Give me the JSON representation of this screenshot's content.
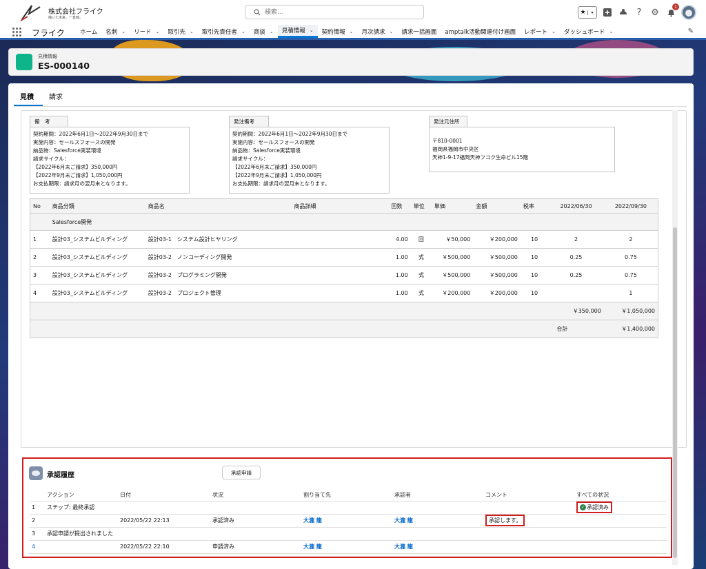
{
  "header": {
    "company": "株式会社フライク",
    "tagline": "描いた未来、一直線。",
    "search_placeholder": "検索...",
    "notification_count": "1"
  },
  "nav": {
    "app_name": "フライク",
    "items": [
      {
        "label": "ホーム",
        "chevron": false
      },
      {
        "label": "名刺",
        "chevron": true
      },
      {
        "label": "リード",
        "chevron": true
      },
      {
        "label": "取引先",
        "chevron": true
      },
      {
        "label": "取引先責任者",
        "chevron": true
      },
      {
        "label": "商談",
        "chevron": true
      },
      {
        "label": "見積情報",
        "chevron": true,
        "active": true
      },
      {
        "label": "契約情報",
        "chevron": true
      },
      {
        "label": "月次請求",
        "chevron": true
      },
      {
        "label": "請求一括画面",
        "chevron": false
      },
      {
        "label": "amptalk活動関連付け画面",
        "chevron": false
      },
      {
        "label": "レポート",
        "chevron": true
      },
      {
        "label": "ダッシュボード",
        "chevron": true
      }
    ]
  },
  "record": {
    "type": "見積情報",
    "name": "ES-000140"
  },
  "tabs": [
    "見積",
    "請求"
  ],
  "notes": {
    "remarks_label": "備　考",
    "remarks_lines": [
      "契約期間：2022年6月1日～2022年9月30日まで",
      "実施内容：セールスフォースの開発",
      "納品物：Salesforce実装環境",
      "請求サイクル：",
      "【2022年6月末ご請求】350,000円",
      "【2022年9月末ご請求】1,050,000円",
      "お支払期限：請求月の翌月末となります。"
    ],
    "order_remarks_label": "発注備考",
    "order_remarks_lines": [
      "契約期間：2022年6月1日～2022年9月30日まで",
      "実施内容：セールスフォースの開発",
      "納品物：Salesforce実装環境",
      "請求サイクル：",
      "【2022年6月末ご請求】350,000円",
      "【2022年9月末ご請求】1,050,000円",
      "お支払期限：請求月の翌月末となります。"
    ],
    "address_label": "発注元住所",
    "address_lines": [
      "〒810-0001",
      "福岡県福岡市中央区",
      "天神1-9-17福岡天神フコク生命ビル15階"
    ]
  },
  "items": {
    "headers": [
      "No",
      "商品分類",
      "商品名",
      "商品詳細",
      "回数",
      "単位",
      "単価",
      "金額",
      "税率",
      "2022/06/30",
      "2022/09/30"
    ],
    "group": "Salesforce開発",
    "rows": [
      {
        "no": "1",
        "category": "設計03_システムビルディング",
        "product": "設計03-1　システム設計ヒヤリング",
        "detail": "",
        "qty": "4.00",
        "unit": "回",
        "price": "￥50,000",
        "amount": "￥200,000",
        "tax": "10",
        "d1": "2",
        "d2": "2"
      },
      {
        "no": "2",
        "category": "設計03_システムビルディング",
        "product": "設計03-2　ノンコーディング開発",
        "detail": "",
        "qty": "1.00",
        "unit": "式",
        "price": "￥500,000",
        "amount": "￥500,000",
        "tax": "10",
        "d1": "0.25",
        "d2": "0.75"
      },
      {
        "no": "3",
        "category": "設計03_システムビルディング",
        "product": "設計03-2　プログラミング開発",
        "detail": "",
        "qty": "1.00",
        "unit": "式",
        "price": "￥500,000",
        "amount": "￥500,000",
        "tax": "10",
        "d1": "0.25",
        "d2": "0.75"
      },
      {
        "no": "4",
        "category": "設計03_システムビルディング",
        "product": "設計03-2　プロジェクト管理",
        "detail": "",
        "qty": "1.00",
        "unit": "式",
        "price": "￥200,000",
        "amount": "￥200,000",
        "tax": "10",
        "d1": "",
        "d2": "1"
      }
    ],
    "subtotal_d1": "￥350,000",
    "subtotal_d2": "￥1,050,000",
    "total_label": "合計",
    "total_value": "￥1,400,000"
  },
  "approval": {
    "title": "承認履歴",
    "button": "承認申請",
    "headers": [
      "アクション",
      "日付",
      "状況",
      "割り当て先",
      "承認者",
      "コメント",
      "すべての状況"
    ],
    "rows": [
      {
        "no": "1",
        "action": "ステップ: 最終承認",
        "date": "",
        "status": "",
        "assignee": "",
        "approver": "",
        "comment": "",
        "overall": "承認済み"
      },
      {
        "no": "2",
        "action": "",
        "date": "2022/05/22 22:13",
        "status": "承認済み",
        "assignee": "大瀧 龍",
        "approver": "大瀧 龍",
        "comment": "承認します。",
        "overall": ""
      },
      {
        "no": "3",
        "action": "承認申請が提出されました",
        "date": "",
        "status": "",
        "assignee": "",
        "approver": "",
        "comment": "",
        "overall": ""
      },
      {
        "no": "4",
        "action": "",
        "date": "2022/05/22 22:10",
        "status": "申請済み",
        "assignee": "大瀧 龍",
        "approver": "大瀧 龍",
        "comment": "",
        "overall": ""
      }
    ]
  },
  "colors": {
    "brand_blue": "#0176d3",
    "highlight_red": "#d01c1c",
    "success_green": "#2e844a",
    "record_icon": "#0eb58a"
  }
}
